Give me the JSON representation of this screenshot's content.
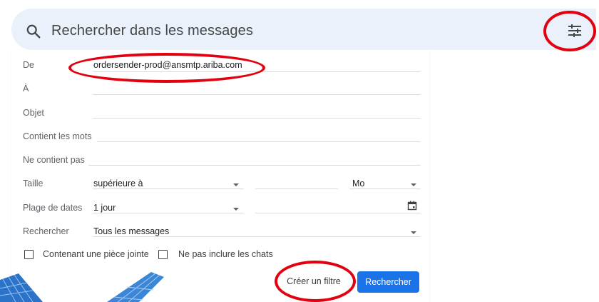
{
  "search": {
    "placeholder": "Rechercher dans les messages",
    "icon": "search-icon",
    "options_icon": "tune-icon"
  },
  "form": {
    "from": {
      "label": "De",
      "value": "ordersender-prod@ansmtp.ariba.com"
    },
    "to": {
      "label": "À",
      "value": ""
    },
    "subject": {
      "label": "Objet",
      "value": ""
    },
    "has_words": {
      "label": "Contient les mots",
      "value": ""
    },
    "doesnt_have": {
      "label": "Ne contient pas",
      "value": ""
    },
    "size": {
      "label": "Taille",
      "operator": "supérieure à",
      "value": "",
      "unit": "Mo"
    },
    "date_range": {
      "label": "Plage de dates",
      "value": "1 jour",
      "date": ""
    },
    "search_in": {
      "label": "Rechercher",
      "value": "Tous les messages"
    },
    "has_attachment": {
      "label": "Contenant une pièce jointe",
      "checked": false
    },
    "exclude_chats": {
      "label": "Ne pas inclure les chats",
      "checked": false
    }
  },
  "buttons": {
    "create_filter": "Créer un filtre",
    "search": "Rechercher"
  },
  "colors": {
    "searchbar_bg": "#eaf1fb",
    "primary_button": "#1a73e8",
    "annotation_red": "#e3000f"
  }
}
